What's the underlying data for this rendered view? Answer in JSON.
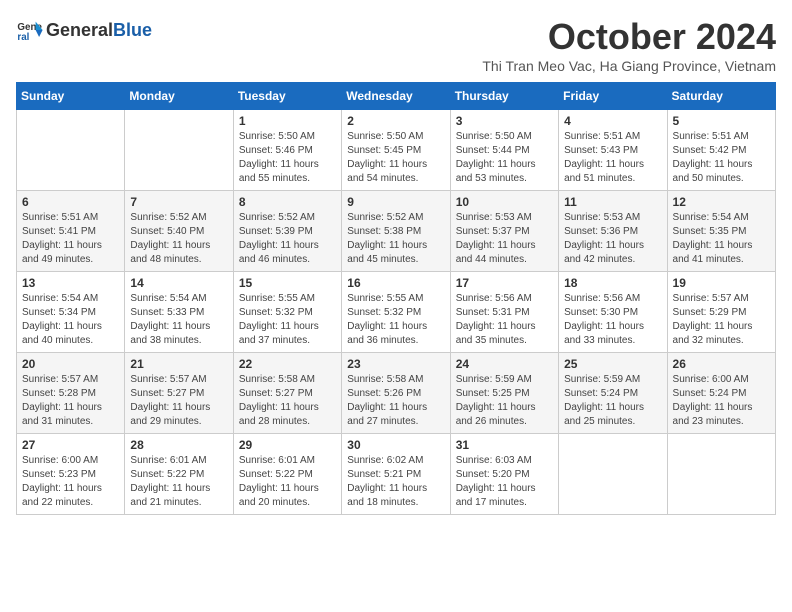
{
  "logo": {
    "general": "General",
    "blue": "Blue"
  },
  "header": {
    "month_title": "October 2024",
    "subtitle": "Thi Tran Meo Vac, Ha Giang Province, Vietnam"
  },
  "weekdays": [
    "Sunday",
    "Monday",
    "Tuesday",
    "Wednesday",
    "Thursday",
    "Friday",
    "Saturday"
  ],
  "weeks": [
    [
      {
        "day": "",
        "info": ""
      },
      {
        "day": "",
        "info": ""
      },
      {
        "day": "1",
        "info": "Sunrise: 5:50 AM\nSunset: 5:46 PM\nDaylight: 11 hours and 55 minutes."
      },
      {
        "day": "2",
        "info": "Sunrise: 5:50 AM\nSunset: 5:45 PM\nDaylight: 11 hours and 54 minutes."
      },
      {
        "day": "3",
        "info": "Sunrise: 5:50 AM\nSunset: 5:44 PM\nDaylight: 11 hours and 53 minutes."
      },
      {
        "day": "4",
        "info": "Sunrise: 5:51 AM\nSunset: 5:43 PM\nDaylight: 11 hours and 51 minutes."
      },
      {
        "day": "5",
        "info": "Sunrise: 5:51 AM\nSunset: 5:42 PM\nDaylight: 11 hours and 50 minutes."
      }
    ],
    [
      {
        "day": "6",
        "info": "Sunrise: 5:51 AM\nSunset: 5:41 PM\nDaylight: 11 hours and 49 minutes."
      },
      {
        "day": "7",
        "info": "Sunrise: 5:52 AM\nSunset: 5:40 PM\nDaylight: 11 hours and 48 minutes."
      },
      {
        "day": "8",
        "info": "Sunrise: 5:52 AM\nSunset: 5:39 PM\nDaylight: 11 hours and 46 minutes."
      },
      {
        "day": "9",
        "info": "Sunrise: 5:52 AM\nSunset: 5:38 PM\nDaylight: 11 hours and 45 minutes."
      },
      {
        "day": "10",
        "info": "Sunrise: 5:53 AM\nSunset: 5:37 PM\nDaylight: 11 hours and 44 minutes."
      },
      {
        "day": "11",
        "info": "Sunrise: 5:53 AM\nSunset: 5:36 PM\nDaylight: 11 hours and 42 minutes."
      },
      {
        "day": "12",
        "info": "Sunrise: 5:54 AM\nSunset: 5:35 PM\nDaylight: 11 hours and 41 minutes."
      }
    ],
    [
      {
        "day": "13",
        "info": "Sunrise: 5:54 AM\nSunset: 5:34 PM\nDaylight: 11 hours and 40 minutes."
      },
      {
        "day": "14",
        "info": "Sunrise: 5:54 AM\nSunset: 5:33 PM\nDaylight: 11 hours and 38 minutes."
      },
      {
        "day": "15",
        "info": "Sunrise: 5:55 AM\nSunset: 5:32 PM\nDaylight: 11 hours and 37 minutes."
      },
      {
        "day": "16",
        "info": "Sunrise: 5:55 AM\nSunset: 5:32 PM\nDaylight: 11 hours and 36 minutes."
      },
      {
        "day": "17",
        "info": "Sunrise: 5:56 AM\nSunset: 5:31 PM\nDaylight: 11 hours and 35 minutes."
      },
      {
        "day": "18",
        "info": "Sunrise: 5:56 AM\nSunset: 5:30 PM\nDaylight: 11 hours and 33 minutes."
      },
      {
        "day": "19",
        "info": "Sunrise: 5:57 AM\nSunset: 5:29 PM\nDaylight: 11 hours and 32 minutes."
      }
    ],
    [
      {
        "day": "20",
        "info": "Sunrise: 5:57 AM\nSunset: 5:28 PM\nDaylight: 11 hours and 31 minutes."
      },
      {
        "day": "21",
        "info": "Sunrise: 5:57 AM\nSunset: 5:27 PM\nDaylight: 11 hours and 29 minutes."
      },
      {
        "day": "22",
        "info": "Sunrise: 5:58 AM\nSunset: 5:27 PM\nDaylight: 11 hours and 28 minutes."
      },
      {
        "day": "23",
        "info": "Sunrise: 5:58 AM\nSunset: 5:26 PM\nDaylight: 11 hours and 27 minutes."
      },
      {
        "day": "24",
        "info": "Sunrise: 5:59 AM\nSunset: 5:25 PM\nDaylight: 11 hours and 26 minutes."
      },
      {
        "day": "25",
        "info": "Sunrise: 5:59 AM\nSunset: 5:24 PM\nDaylight: 11 hours and 25 minutes."
      },
      {
        "day": "26",
        "info": "Sunrise: 6:00 AM\nSunset: 5:24 PM\nDaylight: 11 hours and 23 minutes."
      }
    ],
    [
      {
        "day": "27",
        "info": "Sunrise: 6:00 AM\nSunset: 5:23 PM\nDaylight: 11 hours and 22 minutes."
      },
      {
        "day": "28",
        "info": "Sunrise: 6:01 AM\nSunset: 5:22 PM\nDaylight: 11 hours and 21 minutes."
      },
      {
        "day": "29",
        "info": "Sunrise: 6:01 AM\nSunset: 5:22 PM\nDaylight: 11 hours and 20 minutes."
      },
      {
        "day": "30",
        "info": "Sunrise: 6:02 AM\nSunset: 5:21 PM\nDaylight: 11 hours and 18 minutes."
      },
      {
        "day": "31",
        "info": "Sunrise: 6:03 AM\nSunset: 5:20 PM\nDaylight: 11 hours and 17 minutes."
      },
      {
        "day": "",
        "info": ""
      },
      {
        "day": "",
        "info": ""
      }
    ]
  ]
}
